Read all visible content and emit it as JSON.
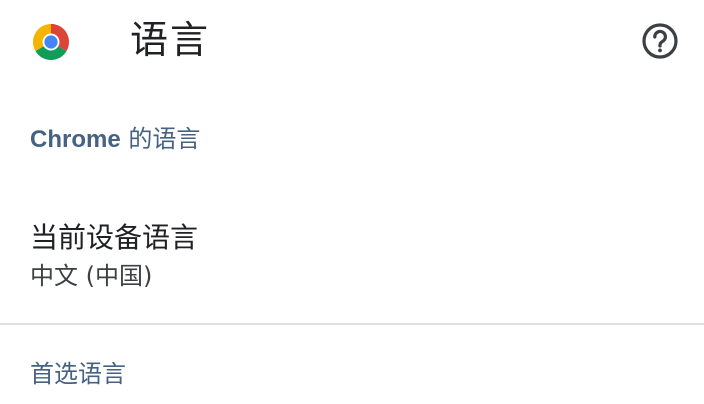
{
  "app_bar": {
    "logo_icon": "chrome-logo-icon",
    "title": "语言",
    "help_icon": "help-circle-icon"
  },
  "sections": {
    "chrome_languages": {
      "brand": "Chrome",
      "rest": " 的语言"
    },
    "preferred_languages": {
      "label": "首选语言"
    }
  },
  "device_language": {
    "title": "当前设备语言",
    "value": "中文 (中国)"
  },
  "colors": {
    "section_header": "#466282",
    "title_text": "#202124",
    "divider": "#e0e0e0",
    "chrome_red": "#DB4437",
    "chrome_yellow": "#F4B400",
    "chrome_green": "#0F9D58",
    "chrome_blue": "#4285F4"
  }
}
